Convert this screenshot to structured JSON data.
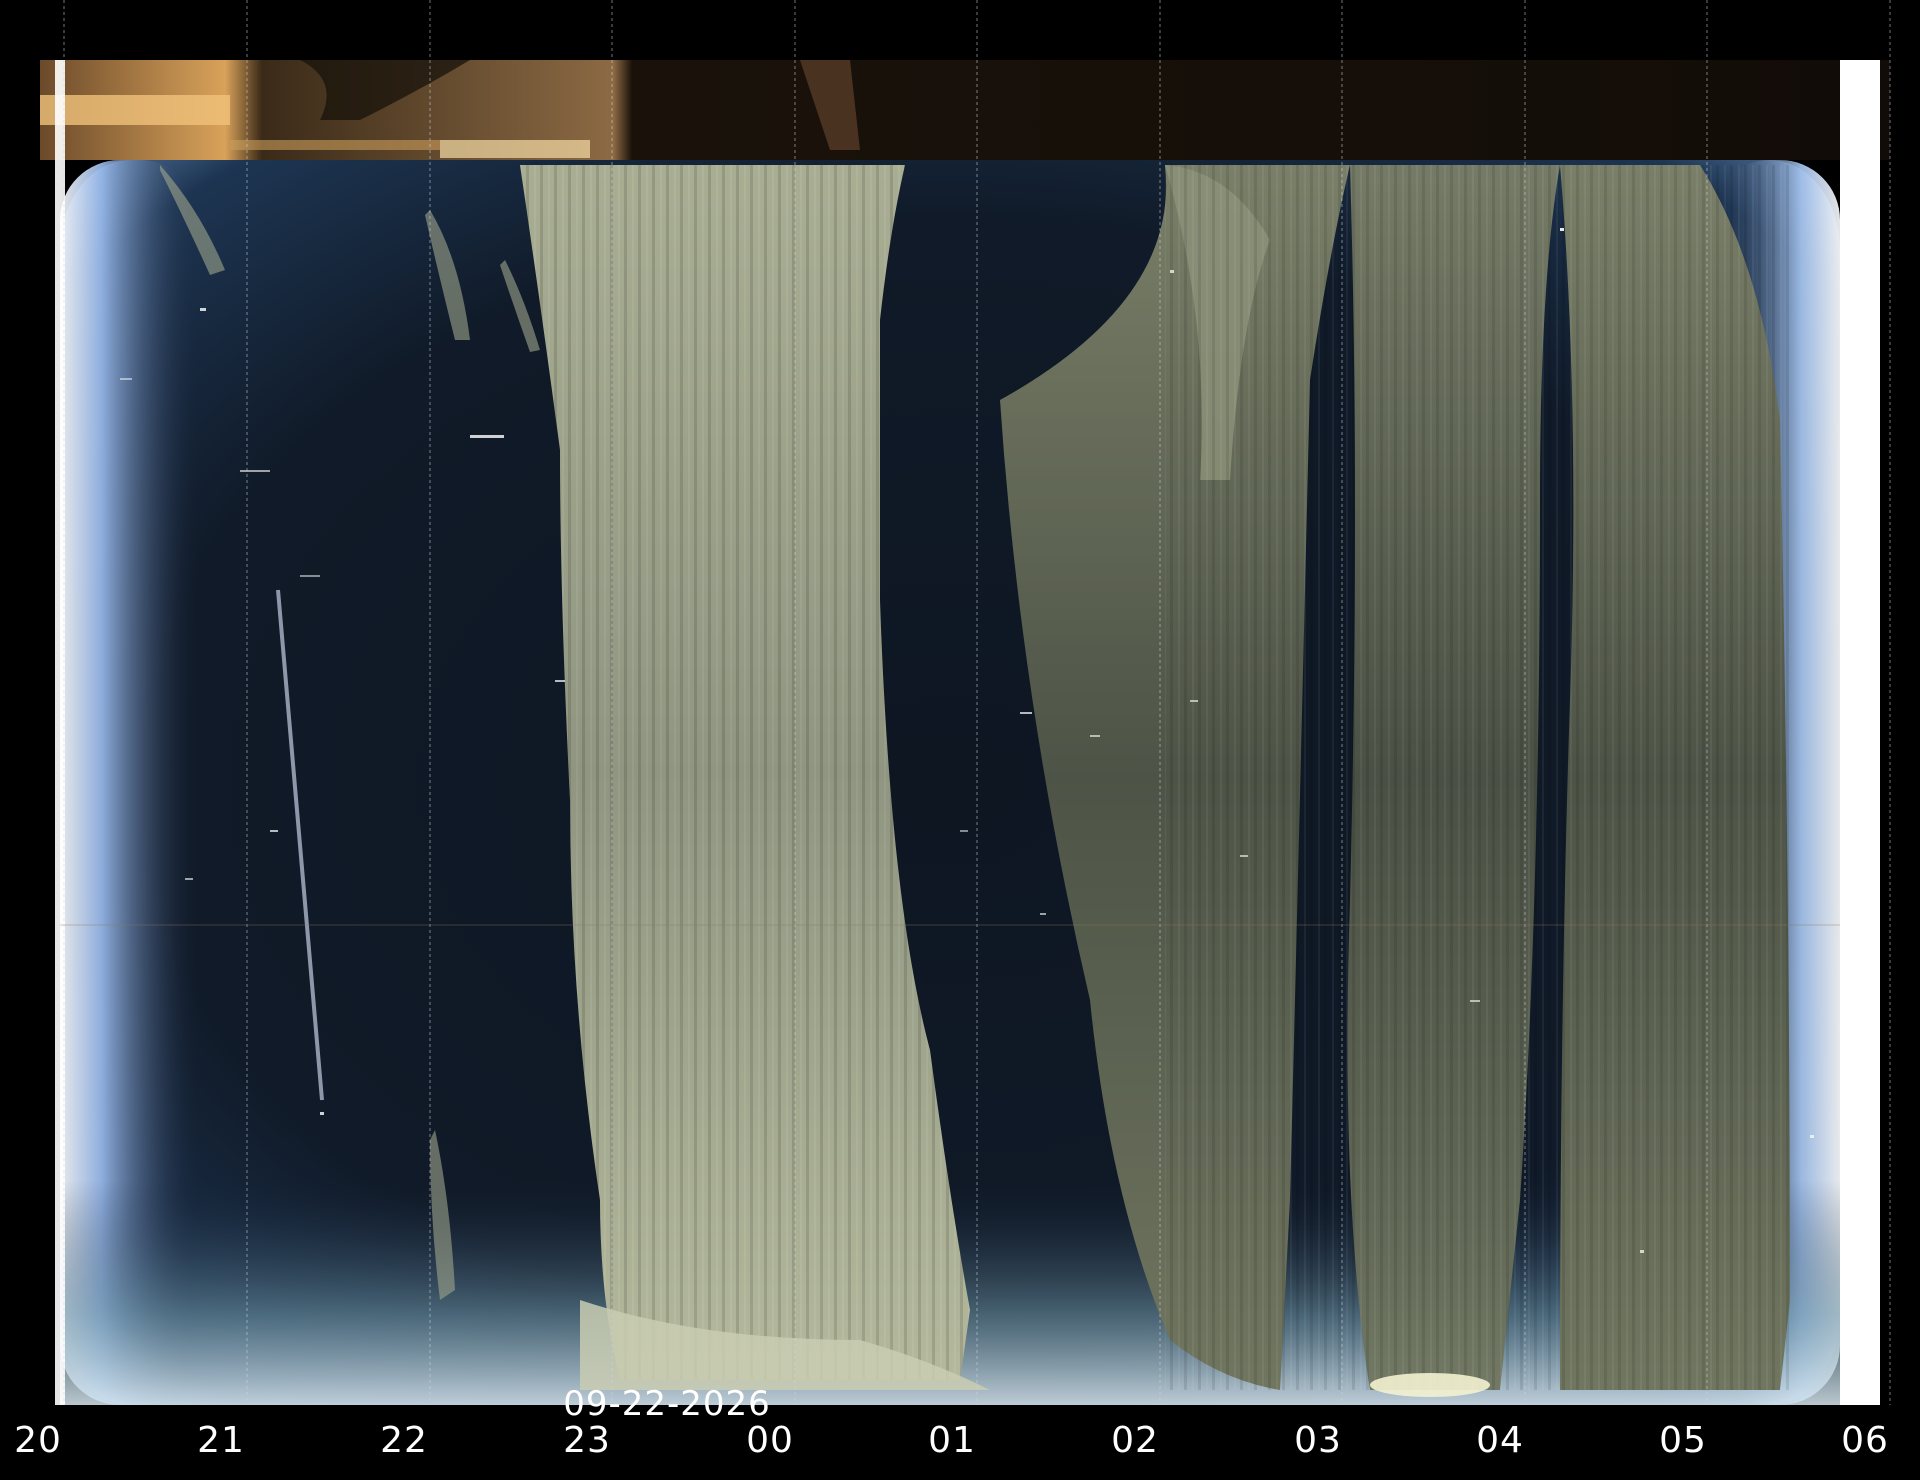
{
  "image": {
    "kind": "all-sky camera keogram (night time-lapse strip)",
    "date": "09-22-2026",
    "hour_labels": [
      "20",
      "21",
      "22",
      "23",
      "00",
      "01",
      "02",
      "03",
      "04",
      "05",
      "06"
    ],
    "colors": {
      "night_sky": "#111a26",
      "cloud_band": "#b8bd9f",
      "horizon_glow": "#cfe4ff",
      "top_strip": "#4a3420",
      "axis_text": "#ffffff",
      "background": "#000000"
    }
  }
}
